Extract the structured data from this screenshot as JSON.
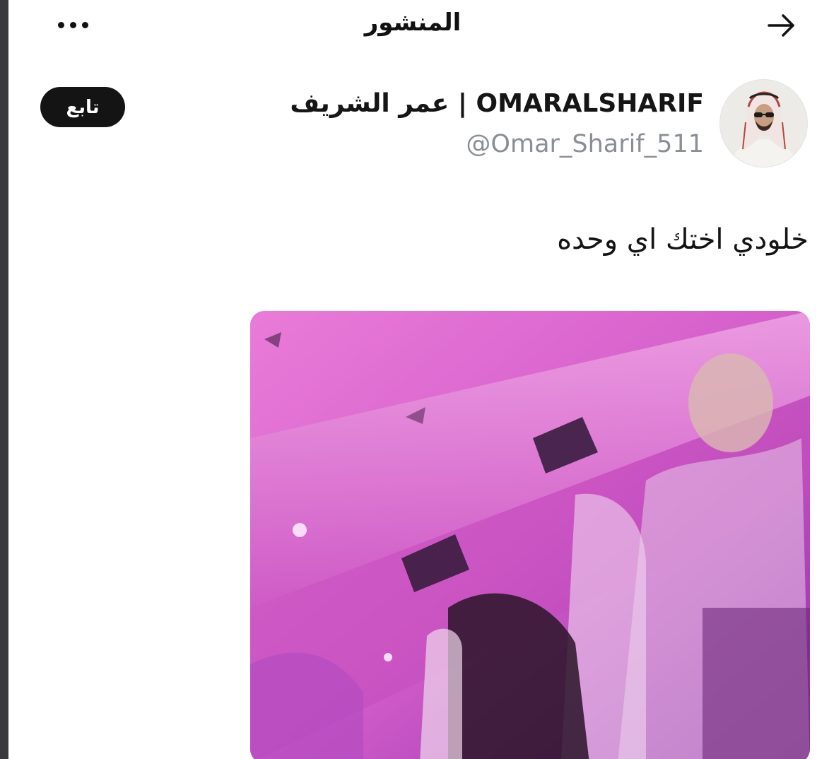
{
  "header": {
    "title": "المنشور",
    "back_icon": "arrow-right-icon",
    "more_icon": "more-horizontal-icon"
  },
  "author": {
    "display_name": "عمر الشريف | OMARALSHARIF",
    "handle": "@Omar_Sharif_511",
    "follow_label": "تابع"
  },
  "post": {
    "text": "خلودي اختك اي وحده"
  },
  "colors": {
    "follow_bg": "#141414",
    "handle": "#8a8f95",
    "media_magenta": "#d94fcf"
  }
}
